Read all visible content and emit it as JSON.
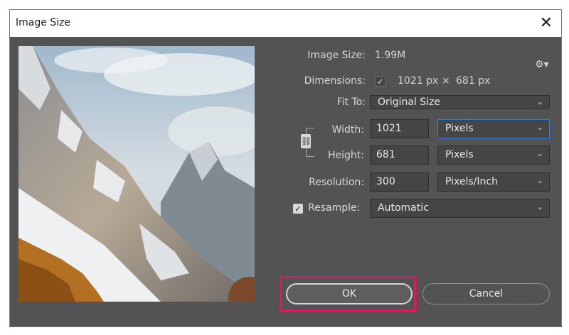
{
  "window": {
    "title": "Image Size",
    "close": "✕"
  },
  "info": {
    "image_size_label": "Image Size:",
    "image_size_value": "1.99M",
    "dimensions_label": "Dimensions:",
    "dimensions_width": "1021 px",
    "dimensions_x": "×",
    "dimensions_height": "681 px"
  },
  "fit_to": {
    "label": "Fit To:",
    "value": "Original Size"
  },
  "width": {
    "label": "Width:",
    "value": "1021",
    "unit": "Pixels"
  },
  "height": {
    "label": "Height:",
    "value": "681",
    "unit": "Pixels"
  },
  "resolution": {
    "label": "Resolution:",
    "value": "300",
    "unit": "Pixels/Inch"
  },
  "resample": {
    "label": "Resample:",
    "checked": true,
    "value": "Automatic"
  },
  "buttons": {
    "ok": "OK",
    "cancel": "Cancel"
  },
  "colors": {
    "dialog_bg": "#535353",
    "highlight": "#e0195f",
    "focus": "#3f7fd3"
  }
}
